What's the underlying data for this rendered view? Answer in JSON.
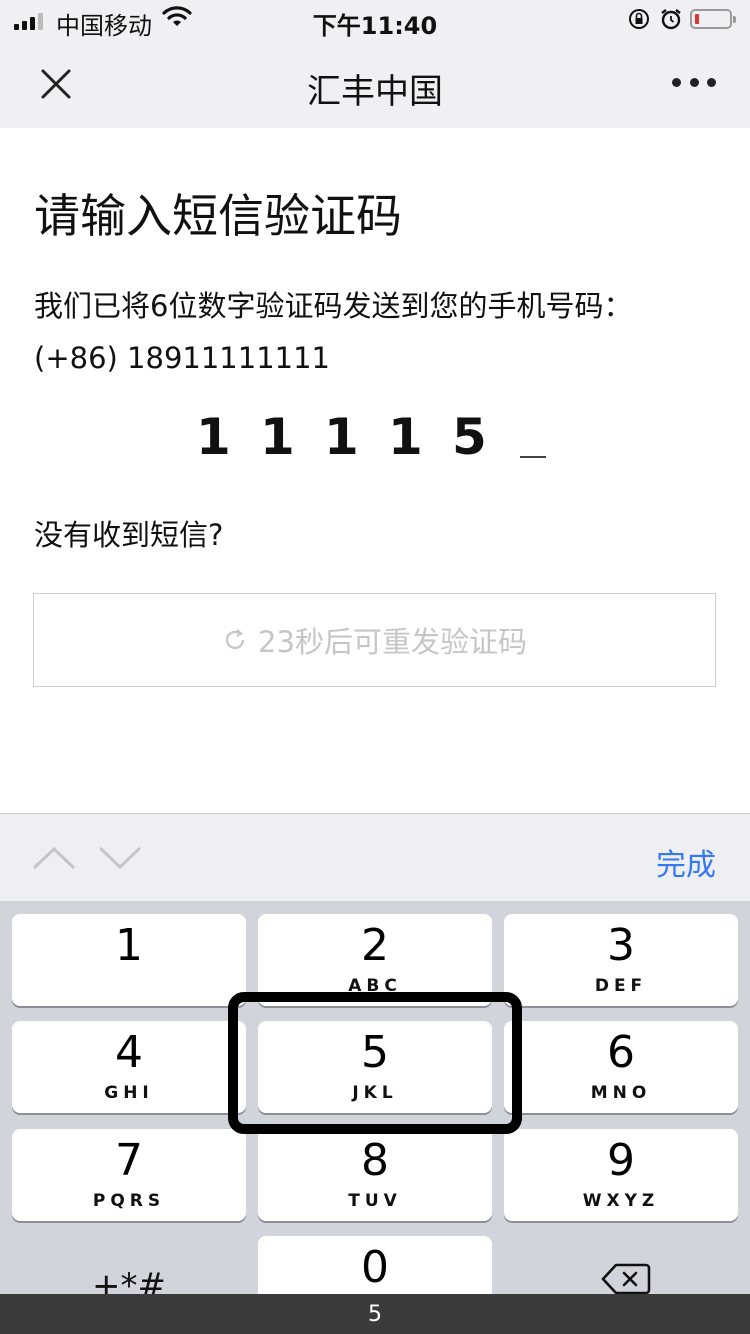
{
  "status_bar": {
    "carrier": "中国移动",
    "time": "下午11:40"
  },
  "nav": {
    "title": "汇丰中国"
  },
  "main": {
    "heading": "请输入短信验证码",
    "description_line1": "我们已将6位数字验证码发送到您的手机号码：",
    "description_line2": "(+86) 18911111111",
    "code_digits": [
      "1",
      "1",
      "1",
      "1",
      "5"
    ],
    "no_sms_text": "没有收到短信?",
    "resend_label": "23秒后可重发验证码"
  },
  "accessory": {
    "done_label": "完成"
  },
  "keypad": {
    "keys": [
      {
        "num": "1",
        "letters": ""
      },
      {
        "num": "2",
        "letters": "ABC"
      },
      {
        "num": "3",
        "letters": "DEF"
      },
      {
        "num": "4",
        "letters": "GHI"
      },
      {
        "num": "5",
        "letters": "JKL"
      },
      {
        "num": "6",
        "letters": "MNO"
      },
      {
        "num": "7",
        "letters": "PQRS"
      },
      {
        "num": "8",
        "letters": "TUV"
      },
      {
        "num": "9",
        "letters": "WXYZ"
      },
      {
        "num": "0",
        "letters": ""
      }
    ],
    "symbols_label": "+*#"
  },
  "caption": "5",
  "colors": {
    "accent": "#3478f6",
    "battery_low": "#e0332d",
    "highlight_border": "#000000"
  },
  "icons": [
    "close-icon",
    "more-icon",
    "refresh-icon",
    "chevron-up-icon",
    "chevron-down-icon",
    "backspace-icon",
    "wifi-icon",
    "alarm-icon",
    "rotation-lock-icon",
    "battery-icon"
  ]
}
